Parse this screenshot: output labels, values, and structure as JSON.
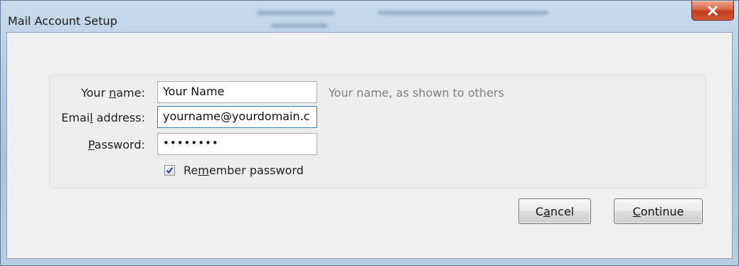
{
  "window": {
    "title": "Mail Account Setup",
    "close_icon": "close-icon"
  },
  "form": {
    "name": {
      "label_pre": "Your ",
      "label_key": "n",
      "label_post": "ame:",
      "value": "Your Name",
      "hint": "Your name, as shown to others"
    },
    "email": {
      "label_pre": "Emai",
      "label_key": "l",
      "label_post": " address:",
      "value": "yourname@yourdomain.c"
    },
    "password": {
      "label_pre": "",
      "label_key": "P",
      "label_post": "assword:",
      "value": "••••••••"
    },
    "remember": {
      "checked": true,
      "label_pre": "Re",
      "label_key": "m",
      "label_post": "ember password"
    }
  },
  "buttons": {
    "cancel": {
      "pre": "C",
      "key": "a",
      "post": "ncel"
    },
    "continue": {
      "pre": "",
      "key": "C",
      "post": "ontinue"
    }
  },
  "colors": {
    "close_button": "#c0391b",
    "dialog_bg": "#f0f0f0",
    "hint_text": "#808080",
    "focus_border": "#3c7fb1"
  }
}
